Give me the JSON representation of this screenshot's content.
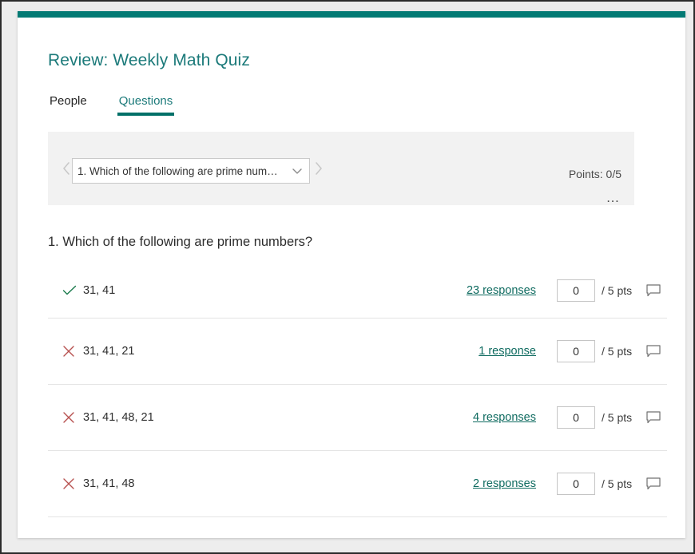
{
  "header": {
    "title": "Review: Weekly Math Quiz"
  },
  "tabs": [
    {
      "label": "People",
      "active": false
    },
    {
      "label": "Questions",
      "active": true
    }
  ],
  "selector": {
    "prev_icon": "chevron-left-icon",
    "next_icon": "chevron-right-icon",
    "dropdown_value": "1. Which of the following are prime num…",
    "dropdown_caret_icon": "chevron-down-icon",
    "points_label": "Points: 0/5",
    "more_label": "…"
  },
  "question": {
    "heading": "1. Which of the following are prime numbers?",
    "options": [
      {
        "mark": "correct",
        "mark_icon": "checkmark-icon",
        "text": "31, 41",
        "responses_label": "23 responses",
        "score_value": "0",
        "points_label": "/ 5 pts",
        "comment_icon": "comment-icon"
      },
      {
        "mark": "wrong",
        "mark_icon": "close-icon",
        "text": "31, 41, 21",
        "responses_label": "1 response",
        "score_value": "0",
        "points_label": "/ 5 pts",
        "comment_icon": "comment-icon"
      },
      {
        "mark": "wrong",
        "mark_icon": "close-icon",
        "text": "31, 41, 48, 21",
        "responses_label": "4 responses",
        "score_value": "0",
        "points_label": "/ 5 pts",
        "comment_icon": "comment-icon"
      },
      {
        "mark": "wrong",
        "mark_icon": "close-icon",
        "text": "31, 41, 48",
        "responses_label": "2 responses",
        "score_value": "0",
        "points_label": "/ 5 pts",
        "comment_icon": "comment-icon"
      }
    ]
  },
  "colors": {
    "accent_teal": "#027a74",
    "title_teal": "#1c7a7a",
    "link_teal": "#0f6b60",
    "correct_green": "#107c41",
    "wrong_red": "#b7514f",
    "panel_gray": "#f2f2f2"
  }
}
